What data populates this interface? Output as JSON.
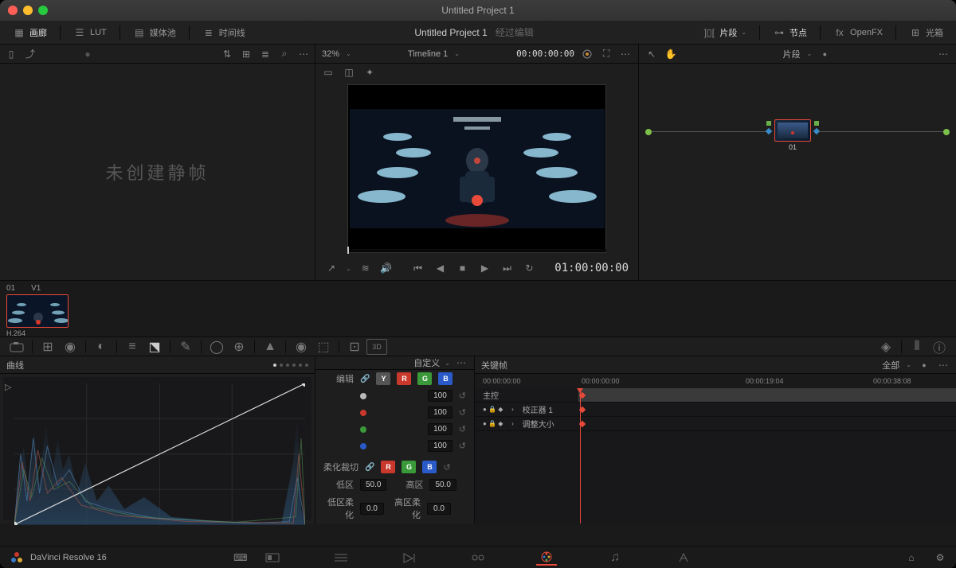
{
  "window_title": "Untitled Project 1",
  "header": {
    "tabs": [
      {
        "icon": "gallery",
        "label": "画廊"
      },
      {
        "icon": "lut",
        "label": "LUT"
      },
      {
        "icon": "media",
        "label": "媒体池"
      },
      {
        "icon": "timeline",
        "label": "时间线"
      }
    ],
    "project_title": "Untitled Project 1",
    "edited": "经过编辑",
    "right": [
      {
        "icon": "clips",
        "label": "片段",
        "chev": true
      },
      {
        "icon": "nodes",
        "label": "节点"
      },
      {
        "icon": "fx",
        "label": "OpenFX"
      },
      {
        "icon": "lightbox",
        "label": "光箱"
      }
    ]
  },
  "gallery": {
    "empty_text": "未创建静帧"
  },
  "viewer": {
    "zoom": "32%",
    "timeline_name": "Timeline 1",
    "tc_hdr": "00:00:00:00",
    "tc_play": "01:00:00:00"
  },
  "nodes": {
    "label": "片段",
    "node_id": "01"
  },
  "clip": {
    "id": "01",
    "track": "V1",
    "codec": "H.264"
  },
  "curves": {
    "title": "曲线",
    "mode": "自定义",
    "edit_label": "编辑",
    "channels": [
      "Y",
      "R",
      "G",
      "B"
    ],
    "params": [
      {
        "color": "#bbb",
        "value": "100"
      },
      {
        "color": "#c8382c",
        "value": "100"
      },
      {
        "color": "#3a9a3a",
        "value": "100"
      },
      {
        "color": "#2a5ac8",
        "value": "100"
      }
    ],
    "soft": {
      "title": "柔化裁切",
      "low_lbl": "低区",
      "low": "50.0",
      "high_lbl": "高区",
      "high": "50.0",
      "ls_lbl": "低区柔化",
      "ls": "0.0",
      "hs_lbl": "高区柔化",
      "hs": "0.0"
    }
  },
  "keyframes": {
    "title": "关键帧",
    "all": "全部",
    "ruler": [
      "00:00:00:00",
      "00:00:00:00",
      "00:00:19:04",
      "00:00:38:08"
    ],
    "rows": [
      {
        "label": "主控",
        "hl": true
      },
      {
        "label": "校正器 1"
      },
      {
        "label": "调整大小"
      }
    ]
  },
  "footer": {
    "app": "DaVinci Resolve 16"
  },
  "colors": {
    "accent": "#e8493a"
  }
}
